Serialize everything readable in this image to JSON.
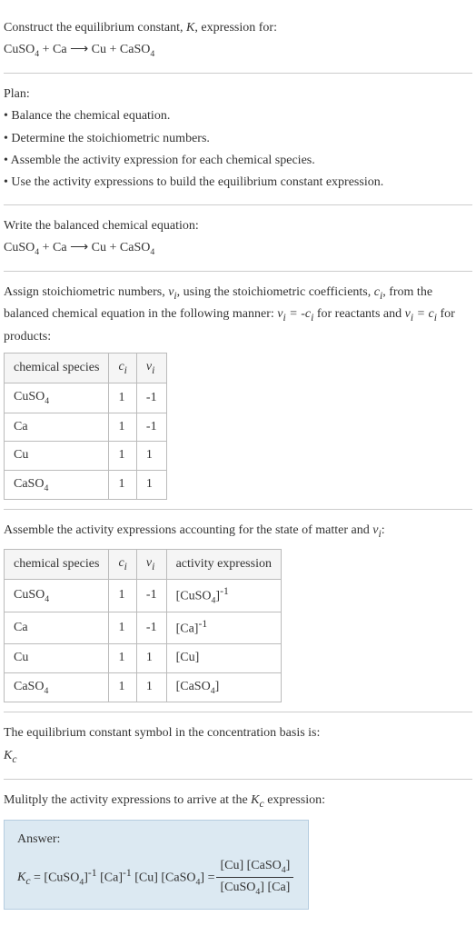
{
  "title_line1": "Construct the equilibrium constant, K, expression for:",
  "equation_html": "CuSO<sub class='sub4'>4</sub> + Ca  ⟶  Cu + CaSO<sub class='sub4'>4</sub>",
  "plan_header": "Plan:",
  "plan_items": [
    "• Balance the chemical equation.",
    "• Determine the stoichiometric numbers.",
    "• Assemble the activity expression for each chemical species.",
    "• Use the activity expressions to build the equilibrium constant expression."
  ],
  "balanced_header": "Write the balanced chemical equation:",
  "stoich_text_a": "Assign stoichiometric numbers, ",
  "stoich_text_b": ", using the stoichiometric coefficients, ",
  "stoich_text_c": ", from the balanced chemical equation in the following manner: ",
  "stoich_text_d": " for reactants and ",
  "stoich_text_e": " for products:",
  "table1": {
    "headers": [
      "chemical species",
      "cᵢ",
      "νᵢ"
    ],
    "rows": [
      {
        "species_html": "CuSO<sub class='sub4'>4</sub>",
        "c": "1",
        "v": "-1"
      },
      {
        "species_html": "Ca",
        "c": "1",
        "v": "-1"
      },
      {
        "species_html": "Cu",
        "c": "1",
        "v": "1"
      },
      {
        "species_html": "CaSO<sub class='sub4'>4</sub>",
        "c": "1",
        "v": "1"
      }
    ]
  },
  "activity_intro_a": "Assemble the activity expressions accounting for the state of matter and ",
  "activity_intro_b": ":",
  "table2": {
    "headers": [
      "chemical species",
      "cᵢ",
      "νᵢ",
      "activity expression"
    ],
    "rows": [
      {
        "species_html": "CuSO<sub class='sub4'>4</sub>",
        "c": "1",
        "v": "-1",
        "act_html": "[CuSO<sub class='sub4'>4</sub>]<sup>-1</sup>"
      },
      {
        "species_html": "Ca",
        "c": "1",
        "v": "-1",
        "act_html": "[Ca]<sup>-1</sup>"
      },
      {
        "species_html": "Cu",
        "c": "1",
        "v": "1",
        "act_html": "[Cu]"
      },
      {
        "species_html": "CaSO<sub class='sub4'>4</sub>",
        "c": "1",
        "v": "1",
        "act_html": "[CaSO<sub class='sub4'>4</sub>]"
      }
    ]
  },
  "conc_basis_line1": "The equilibrium constant symbol in the concentration basis is:",
  "kc_symbol_html": "<span class='ital'>K<sub>c</sub></span>",
  "multiply_line_a": "Mulitply the activity expressions to arrive at the ",
  "multiply_line_b": " expression:",
  "answer_label": "Answer:",
  "answer_lhs_html": "<span class='ital'>K<sub>c</sub></span> = [CuSO<sub class='sub4'>4</sub>]<sup>-1</sup> [Ca]<sup>-1</sup> [Cu] [CaSO<sub class='sub4'>4</sub>] = ",
  "answer_num_html": "[Cu] [CaSO<sub class='sub4'>4</sub>]",
  "answer_den_html": "[CuSO<sub class='sub4'>4</sub>] [Ca]",
  "chart_data": {
    "type": "table",
    "tables": [
      {
        "headers": [
          "chemical species",
          "c_i",
          "ν_i"
        ],
        "rows": [
          [
            "CuSO4",
            1,
            -1
          ],
          [
            "Ca",
            1,
            -1
          ],
          [
            "Cu",
            1,
            1
          ],
          [
            "CaSO4",
            1,
            1
          ]
        ]
      },
      {
        "headers": [
          "chemical species",
          "c_i",
          "ν_i",
          "activity expression"
        ],
        "rows": [
          [
            "CuSO4",
            1,
            -1,
            "[CuSO4]^-1"
          ],
          [
            "Ca",
            1,
            -1,
            "[Ca]^-1"
          ],
          [
            "Cu",
            1,
            1,
            "[Cu]"
          ],
          [
            "CaSO4",
            1,
            1,
            "[CaSO4]"
          ]
        ]
      }
    ]
  }
}
